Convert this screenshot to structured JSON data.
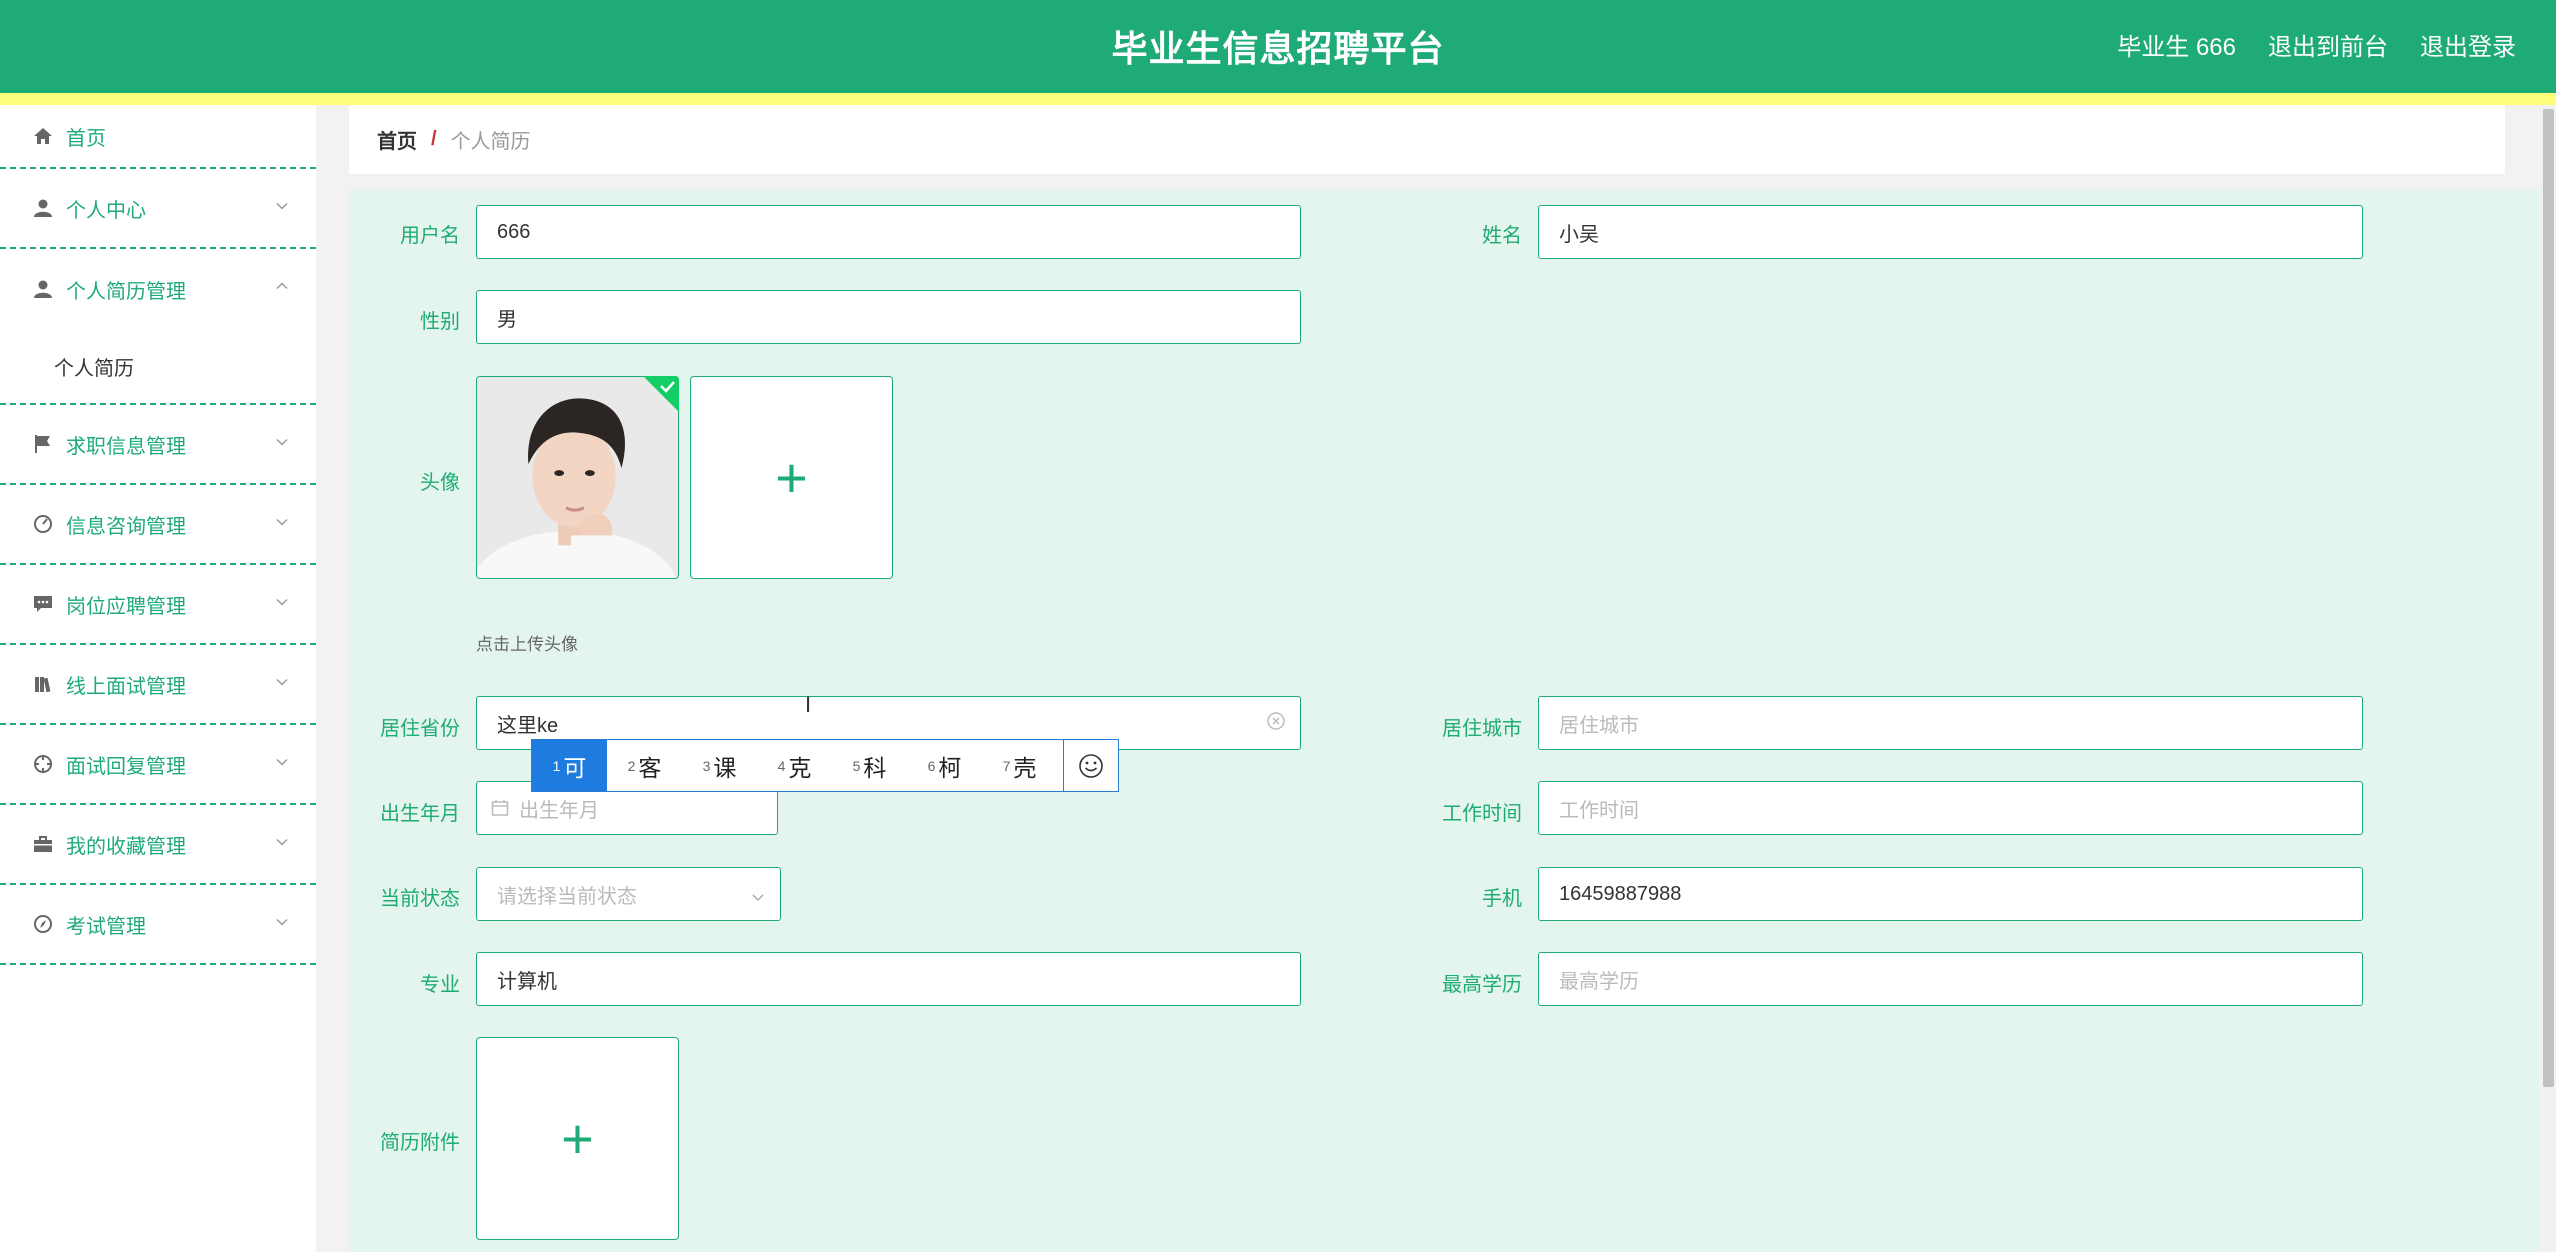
{
  "header": {
    "title": "毕业生信息招聘平台",
    "user_label": "毕业生 666",
    "to_front": "退出到前台",
    "logout": "退出登录"
  },
  "sidebar": {
    "items": [
      {
        "label": "首页",
        "icon": "home-icon"
      },
      {
        "label": "个人中心",
        "icon": "user-icon"
      },
      {
        "label": "个人简历管理",
        "icon": "user-icon"
      },
      {
        "label": "求职信息管理",
        "icon": "flag-icon"
      },
      {
        "label": "信息咨询管理",
        "icon": "dashboard-icon"
      },
      {
        "label": "岗位应聘管理",
        "icon": "message-icon"
      },
      {
        "label": "线上面试管理",
        "icon": "books-icon"
      },
      {
        "label": "面试回复管理",
        "icon": "target-icon"
      },
      {
        "label": "我的收藏管理",
        "icon": "briefcase-icon"
      },
      {
        "label": "考试管理",
        "icon": "compass-icon"
      }
    ],
    "sub_items": [
      "个人简历"
    ]
  },
  "breadcrumb": {
    "home": "首页",
    "separator": "/",
    "current": "个人简历"
  },
  "form": {
    "username": {
      "label": "用户名",
      "value": "666"
    },
    "name": {
      "label": "姓名",
      "value": "小吴"
    },
    "gender": {
      "label": "性别",
      "value": "男"
    },
    "avatar": {
      "label": "头像",
      "hint": "点击上传头像"
    },
    "province": {
      "label": "居住省份",
      "value": "这里ke"
    },
    "city": {
      "label": "居住城市",
      "placeholder": "居住城市"
    },
    "birth": {
      "label": "出生年月",
      "placeholder": "出生年月"
    },
    "work_time": {
      "label": "工作时间",
      "placeholder": "工作时间"
    },
    "status": {
      "label": "当前状态",
      "placeholder": "请选择当前状态"
    },
    "phone": {
      "label": "手机",
      "value": "16459887988"
    },
    "major": {
      "label": "专业",
      "value": "计算机"
    },
    "education": {
      "label": "最高学历",
      "placeholder": "最高学历"
    },
    "attachment": {
      "label": "简历附件"
    }
  },
  "ime": {
    "candidates": [
      {
        "num": "1",
        "char": "可"
      },
      {
        "num": "2",
        "char": "客"
      },
      {
        "num": "3",
        "char": "课"
      },
      {
        "num": "4",
        "char": "克"
      },
      {
        "num": "5",
        "char": "科"
      },
      {
        "num": "6",
        "char": "柯"
      },
      {
        "num": "7",
        "char": "壳"
      }
    ]
  },
  "colors": {
    "primary": "#1fab78",
    "accent_bar": "#fdfd7a",
    "form_bg": "#e4f5ee",
    "ime_highlight": "#1e7be0"
  }
}
